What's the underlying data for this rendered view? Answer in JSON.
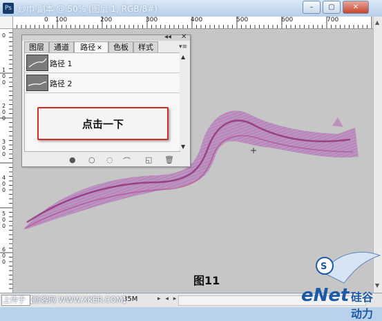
{
  "window": {
    "title": "纱巾 副本 @ 50% (图层 1, RGB/8#)",
    "app_icon": "Ps",
    "controls": [
      "–",
      "▢",
      "✕"
    ]
  },
  "rulers": {
    "top_labels": [
      "0",
      "100",
      "200",
      "300",
      "400",
      "500",
      "600",
      "700"
    ],
    "left_labels": [
      "0",
      "100",
      "200",
      "300",
      "400",
      "500",
      "600"
    ]
  },
  "panel": {
    "tabs": [
      {
        "label": "图层",
        "active": false
      },
      {
        "label": "通道",
        "active": false
      },
      {
        "label": "路径",
        "active": true
      },
      {
        "label": "色板",
        "active": false
      },
      {
        "label": "样式",
        "active": false
      }
    ],
    "collapse_icon": "◂◂",
    "close_icon": "✕",
    "menu_icon": "▾≡",
    "paths": [
      {
        "label": "路径 1"
      },
      {
        "label": "路径 2"
      }
    ],
    "footer_icons": [
      "fill-path-icon",
      "stroke-path-icon",
      "load-selection-icon",
      "make-workpath-icon",
      "new-path-icon",
      "delete-path-icon"
    ]
  },
  "callout": {
    "text": "点击一下"
  },
  "figure_label": "图11",
  "status": {
    "watermark": "上传于【新客网 WWW.XKER.COM】",
    "doc_size": "35M"
  },
  "logo": {
    "main": "eNet",
    "sub": "硅谷动力"
  },
  "colors": {
    "canvas": "#c6c6c6",
    "ribbon_primary": "#b0478f",
    "ribbon_secondary": "#9a7bbd",
    "callout_border": "#d32a26"
  }
}
